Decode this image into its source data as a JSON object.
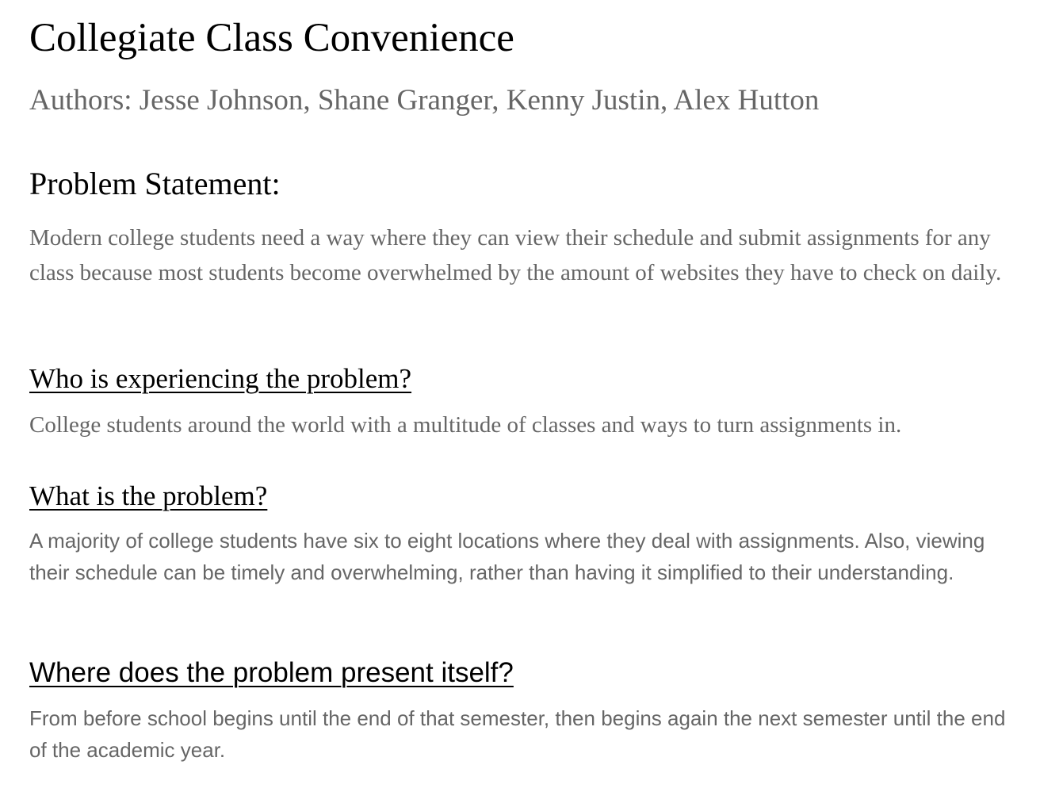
{
  "title": "Collegiate Class Convenience",
  "authors": "Authors: Jesse Johnson, Shane Granger, Kenny Justin, Alex Hutton",
  "problem_statement": {
    "heading": "Problem Statement:",
    "body": "Modern college students need a way where they can view their schedule and submit assignments for any class because most students become overwhelmed by the amount of websites they have to check on daily."
  },
  "sections": [
    {
      "question": "Who is experiencing the problem?",
      "answer": "College students around the world with a multitude of classes and ways to turn assignments in."
    },
    {
      "question": "What is the problem?",
      "answer": "A majority of college students have six to eight locations where they deal with assignments. Also, viewing their schedule can be timely and overwhelming, rather than having it simplified to their understanding."
    },
    {
      "question": "Where does the problem present itself?",
      "answer": "From before school begins until the end of that semester, then begins again the next semester until the end of the academic year."
    }
  ]
}
